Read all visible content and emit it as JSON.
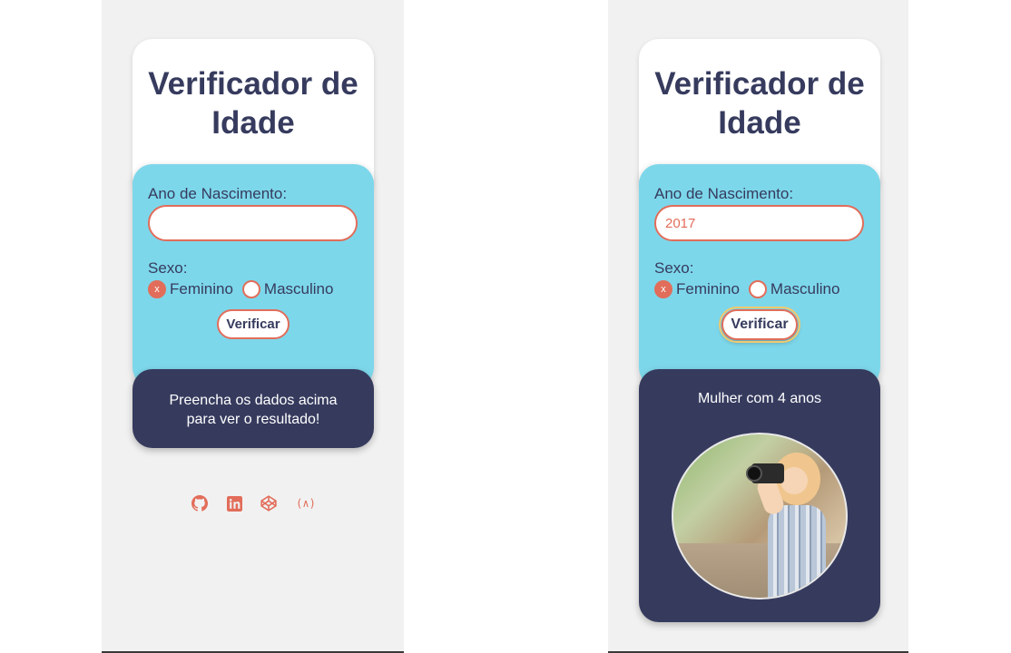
{
  "left": {
    "title": "Verificador de Idade",
    "form": {
      "birth_year_label": "Ano de Nascimento:",
      "birth_year_value": "",
      "sex_label": "Sexo:",
      "option_female": "Feminino",
      "option_male": "Masculino",
      "selected_mark": "x",
      "button_label": "Verificar"
    },
    "result": {
      "line1": "Preencha os dados acima",
      "line2": "para ver o resultado!"
    },
    "footer_icons": [
      "github-icon",
      "linkedin-icon",
      "codepen-icon",
      "freecodecamp-icon"
    ]
  },
  "right": {
    "title": "Verificador de Idade",
    "form": {
      "birth_year_label": "Ano de Nascimento:",
      "birth_year_value": "2017",
      "sex_label": "Sexo:",
      "option_female": "Feminino",
      "option_male": "Masculino",
      "selected_mark": "x",
      "button_label": "Verificar"
    },
    "result": {
      "text": "Mulher com 4 anos"
    }
  },
  "colors": {
    "accent": "#e26d5a",
    "navy": "#363b5e",
    "cyan": "#7dd7ea",
    "background": "#f1f1f1"
  }
}
